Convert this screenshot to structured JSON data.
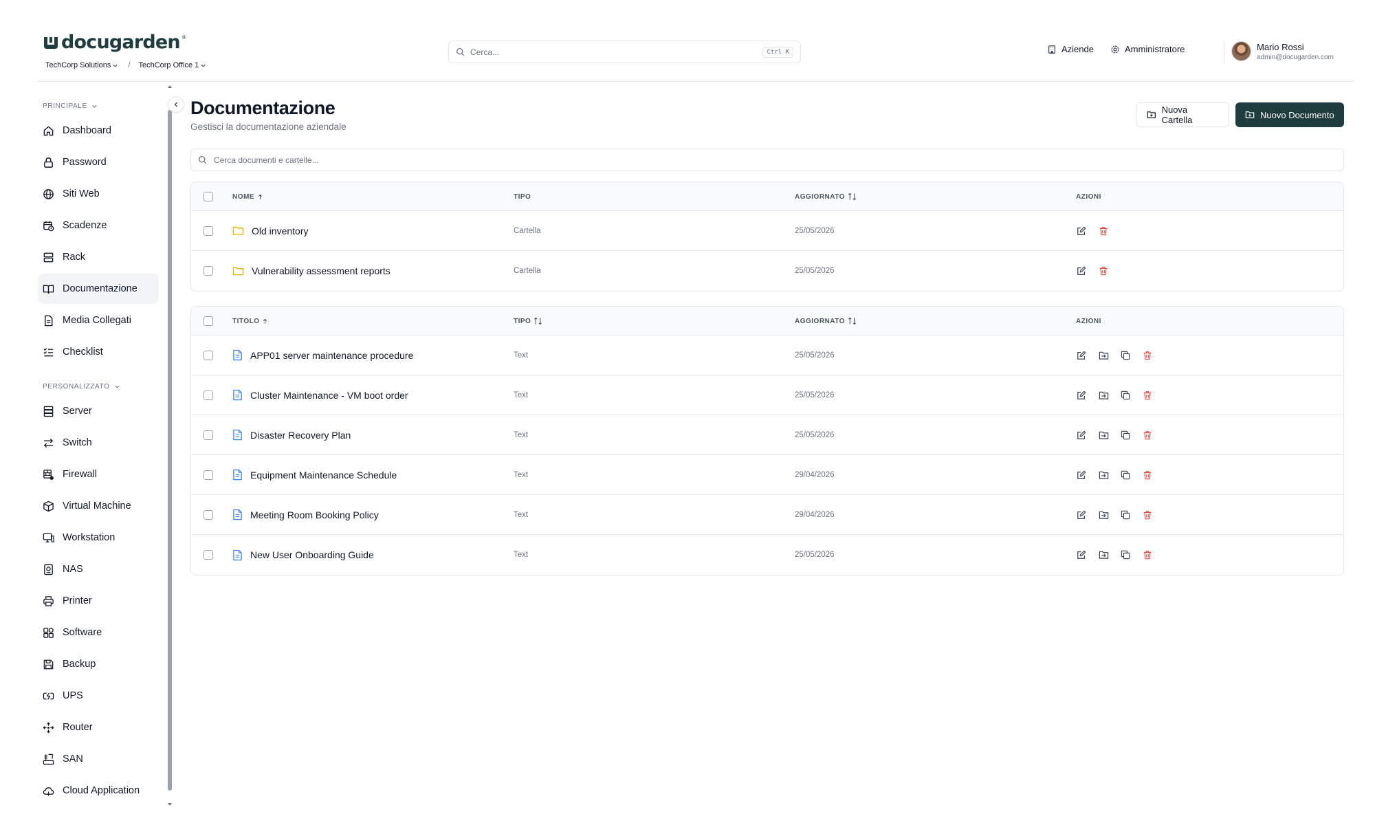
{
  "brand": {
    "name": "docugarden",
    "registered": "®",
    "color": "#1f3c3f"
  },
  "breadcrumb": {
    "company": "TechCorp Solutions",
    "separator": "/",
    "office": "TechCorp Office 1"
  },
  "global_search": {
    "placeholder": "Cerca...",
    "shortcut": "Ctrl K"
  },
  "header_nav": {
    "companies": "Aziende",
    "admin": "Amministratore"
  },
  "user": {
    "name": "Mario Rossi",
    "email": "admin@docugarden.com"
  },
  "sidebar": {
    "sections": [
      {
        "label": "PRINCIPALE",
        "items": [
          {
            "label": "Dashboard",
            "icon": "home-icon"
          },
          {
            "label": "Password",
            "icon": "lock-icon"
          },
          {
            "label": "Siti Web",
            "icon": "globe-icon"
          },
          {
            "label": "Scadenze",
            "icon": "calendar-clock-icon"
          },
          {
            "label": "Rack",
            "icon": "rack-icon"
          },
          {
            "label": "Documentazione",
            "icon": "book-open-icon",
            "active": true
          },
          {
            "label": "Media Collegati",
            "icon": "file-icon"
          },
          {
            "label": "Checklist",
            "icon": "checklist-icon"
          }
        ]
      },
      {
        "label": "PERSONALIZZATO",
        "items": [
          {
            "label": "Server",
            "icon": "server-icon"
          },
          {
            "label": "Switch",
            "icon": "switch-arrows-icon"
          },
          {
            "label": "Firewall",
            "icon": "firewall-icon"
          },
          {
            "label": "Virtual Machine",
            "icon": "box-icon"
          },
          {
            "label": "Workstation",
            "icon": "monitor-icon"
          },
          {
            "label": "NAS",
            "icon": "nas-icon"
          },
          {
            "label": "Printer",
            "icon": "printer-icon"
          },
          {
            "label": "Software",
            "icon": "software-icon"
          },
          {
            "label": "Backup",
            "icon": "save-icon"
          },
          {
            "label": "UPS",
            "icon": "ups-icon"
          },
          {
            "label": "Router",
            "icon": "router-icon"
          },
          {
            "label": "SAN",
            "icon": "san-icon"
          },
          {
            "label": "Cloud Application",
            "icon": "cloud-icon"
          }
        ]
      }
    ]
  },
  "page": {
    "title": "Documentazione",
    "subtitle": "Gestisci la documentazione aziendale",
    "new_folder_label": "Nuova Cartella",
    "new_document_label": "Nuovo Documento",
    "search_placeholder": "Cerca documenti e cartelle..."
  },
  "folders_table": {
    "headers": {
      "name": "NOME",
      "type": "TIPO",
      "updated": "AGGIORNATO",
      "actions": "AZIONI"
    },
    "rows": [
      {
        "name": "Old inventory",
        "type": "Cartella",
        "updated": "25/05/2026"
      },
      {
        "name": "Vulnerability assessment reports",
        "type": "Cartella",
        "updated": "25/05/2026"
      }
    ]
  },
  "documents_table": {
    "headers": {
      "title": "TITOLO",
      "type": "TIPO",
      "updated": "AGGIORNATO",
      "actions": "AZIONI"
    },
    "rows": [
      {
        "title": "APP01 server maintenance procedure",
        "type": "Text",
        "updated": "25/05/2026"
      },
      {
        "title": "Cluster Maintenance - VM boot order",
        "type": "Text",
        "updated": "25/05/2026"
      },
      {
        "title": "Disaster Recovery Plan",
        "type": "Text",
        "updated": "25/05/2026"
      },
      {
        "title": "Equipment Maintenance Schedule",
        "type": "Text",
        "updated": "29/04/2026"
      },
      {
        "title": "Meeting Room Booking Policy",
        "type": "Text",
        "updated": "29/04/2026"
      },
      {
        "title": "New User Onboarding Guide",
        "type": "Text",
        "updated": "25/05/2026"
      }
    ]
  },
  "colors": {
    "primary": "#1f3c3f",
    "folder": "#eab308",
    "document": "#3b82f6",
    "danger": "#ef4444",
    "muted": "#6b7280",
    "border": "#e5e7eb"
  }
}
